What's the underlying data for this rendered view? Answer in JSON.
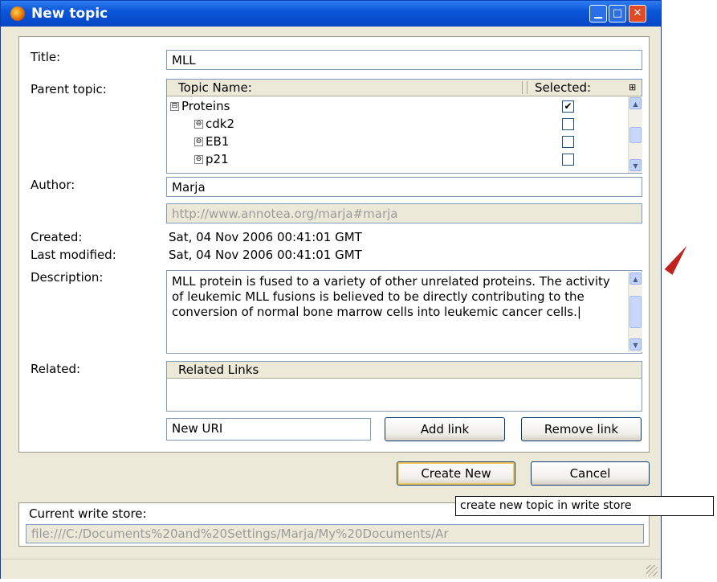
{
  "window": {
    "title": "New topic"
  },
  "form": {
    "title_label": "Title:",
    "title_value": "MLL",
    "parent_label": "Parent topic:",
    "tree": {
      "col_name": "Topic Name:",
      "col_selected": "Selected:",
      "rows": [
        {
          "label": "Proteins",
          "toggle": "⊟",
          "checked": true
        },
        {
          "label": "cdk2",
          "toggle": "⊖",
          "checked": false
        },
        {
          "label": "EB1",
          "toggle": "⊖",
          "checked": false
        },
        {
          "label": "p21",
          "toggle": "⊖",
          "checked": false
        }
      ]
    },
    "author_label": "Author:",
    "author_value": "Marja",
    "author_uri": "http://www.annotea.org/marja#marja",
    "created_label": "Created:",
    "created_value": "Sat, 04 Nov 2006 00:41:01 GMT",
    "modified_label": "Last modified:",
    "modified_value": "Sat, 04 Nov 2006 00:41:01 GMT",
    "description_label": "Description:",
    "description_value": "MLL protein is fused to a variety of other unrelated proteins. The activity of leukemic MLL fusions is believed to be directly contributing to the conversion of normal bone marrow cells into leukemic cancer cells.",
    "related_label": "Related:",
    "related_header": "Related Links",
    "new_uri_value": "New URI",
    "add_link": "Add link",
    "remove_link": "Remove link"
  },
  "actions": {
    "create_new": "Create New",
    "cancel": "Cancel"
  },
  "write_store": {
    "label": "Current write store:",
    "path": "file:///C:/Documents%20and%20Settings/Marja/My%20Documents/Ar"
  },
  "tooltip": "create new topic in write store",
  "colors": {
    "titlebar": "#0a56d8",
    "arrow": "#c0221c",
    "default_button_highlight": "#f6c85b"
  }
}
